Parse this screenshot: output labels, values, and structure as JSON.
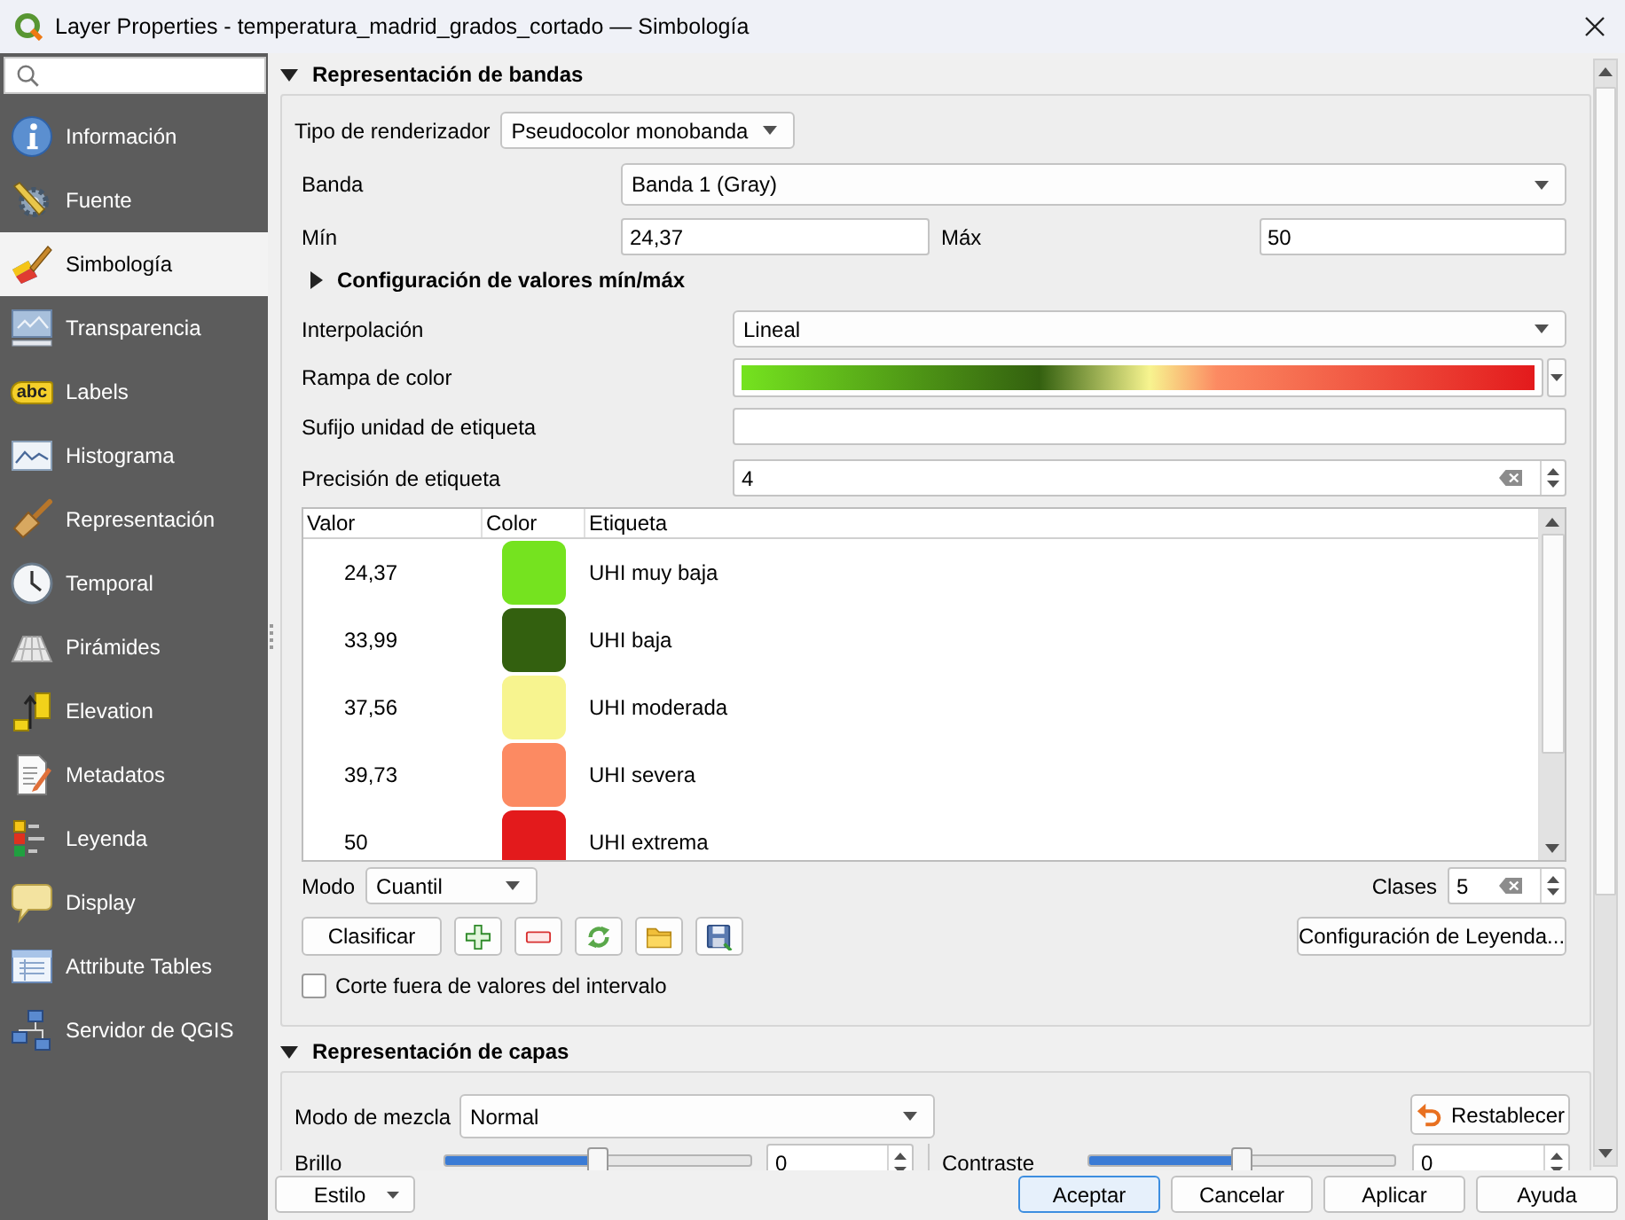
{
  "window": {
    "title": "Layer Properties - temperatura_madrid_grados_cortado — Simbología"
  },
  "sidebar": {
    "items": [
      {
        "label": "Información",
        "selected": false
      },
      {
        "label": "Fuente",
        "selected": false
      },
      {
        "label": "Simbología",
        "selected": true
      },
      {
        "label": "Transparencia",
        "selected": false
      },
      {
        "label": "Labels",
        "selected": false,
        "icon_text": "abc"
      },
      {
        "label": "Histograma",
        "selected": false
      },
      {
        "label": "Representación",
        "selected": false
      },
      {
        "label": "Temporal",
        "selected": false
      },
      {
        "label": "Pirámides",
        "selected": false
      },
      {
        "label": "Elevation",
        "selected": false
      },
      {
        "label": "Metadatos",
        "selected": false
      },
      {
        "label": "Leyenda",
        "selected": false
      },
      {
        "label": "Display",
        "selected": false
      },
      {
        "label": "Attribute Tables",
        "selected": false
      },
      {
        "label": "Servidor de QGIS",
        "selected": false
      }
    ]
  },
  "band_rendering": {
    "title": "Representación de bandas",
    "expanded": true,
    "renderer": {
      "label": "Tipo de renderizador",
      "value": "Pseudocolor monobanda"
    },
    "band": {
      "label": "Banda",
      "value": "Banda 1 (Gray)"
    },
    "min": {
      "label": "Mín",
      "value": "24,37"
    },
    "max": {
      "label": "Máx",
      "value": "50"
    },
    "minmax_settings": {
      "title": "Configuración de valores mín/máx",
      "expanded": false
    },
    "interpolation": {
      "label": "Interpolación",
      "value": "Lineal"
    },
    "color_ramp": {
      "label": "Rampa de color"
    },
    "label_suffix": {
      "label": "Sufijo unidad de etiqueta"
    },
    "label_precision": {
      "label": "Precisión de etiqueta",
      "value": "4"
    },
    "table": {
      "columns": [
        "Valor",
        "Color",
        "Etiqueta"
      ],
      "rows": [
        {
          "value": "24,37",
          "color": "#75e31f",
          "label": "UHI muy baja"
        },
        {
          "value": "33,99",
          "color": "#33600f",
          "label": "UHI baja"
        },
        {
          "value": "37,56",
          "color": "#f7f48f",
          "label": "UHI moderada"
        },
        {
          "value": "39,73",
          "color": "#fc8a62",
          "label": "UHI severa"
        },
        {
          "value": "50",
          "color": "#e31a1c",
          "label": "UHI extrema"
        }
      ]
    },
    "mode": {
      "label": "Modo",
      "value": "Cuantil"
    },
    "classes": {
      "label": "Clases",
      "value": "5"
    },
    "classify_button": "Clasificar",
    "legend_button": "Configuración de Leyenda...",
    "clip_out_of_range": {
      "label": "Corte fuera de valores del intervalo",
      "checked": false
    }
  },
  "layer_rendering": {
    "title": "Representación de capas",
    "expanded": true,
    "blending_mode": {
      "label": "Modo de mezcla",
      "value": "Normal"
    },
    "reset_button": "Restablecer",
    "brightness": {
      "label": "Brillo",
      "level": 0.5,
      "value": "0"
    },
    "contrast": {
      "label": "Contraste",
      "level": 0.5,
      "value": "0"
    }
  },
  "footer": {
    "style_button": "Estilo",
    "buttons": [
      {
        "label": "Aceptar",
        "focused": true
      },
      {
        "label": "Cancelar",
        "focused": false
      },
      {
        "label": "Aplicar",
        "focused": false
      },
      {
        "label": "Ayuda",
        "focused": false
      }
    ]
  }
}
